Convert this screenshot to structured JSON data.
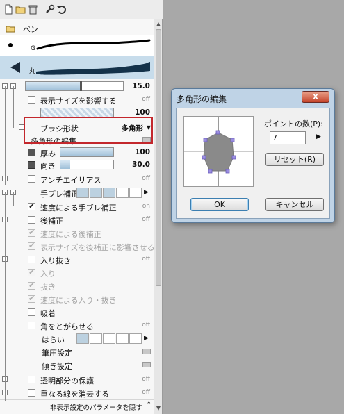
{
  "panel": {
    "brush_tool_label": "ペン",
    "stroke1_label": "G",
    "stroke2_label": "丸",
    "size_value": "15.0",
    "show_size_label": "表示サイズを影響する",
    "show_size_state": "off",
    "density_value": "100",
    "brush_shape_label": "ブラシ形状",
    "brush_shape_value": "多角形",
    "edit_polygon_label": "多角形の編集...",
    "thickness_label": "厚み",
    "thickness_value": "100",
    "direction_label": "向き",
    "direction_value": "30.0",
    "antialias_label": "アンチエイリアス",
    "antialias_state": "off",
    "stabilizer_label": "手ブレ補正",
    "speed_stabilizer_label": "速度による手ブレ補正",
    "speed_stabilizer_state": "on",
    "post_correction_label": "後補正",
    "post_correction_state": "off",
    "speed_post_label": "速度による後補正",
    "show_size_post_label": "表示サイズを後補正に影響させる",
    "taper_label": "入り抜き",
    "taper_state": "off",
    "taper_in_label": "入り",
    "taper_out_label": "抜き",
    "speed_taper_label": "速度による入り・抜き",
    "snap_label": "吸着",
    "sharp_corners_label": "角をとがらせる",
    "sharp_corners_state": "off",
    "flick_label": "はらい",
    "pressure_label": "筆圧設定",
    "tilt_label": "傾き設定",
    "protect_alpha_label": "透明部分の保護",
    "protect_alpha_state": "off",
    "erase_overlap_label": "重なる線を消去する",
    "erase_overlap_state": "off",
    "hide_params_label": "非表示設定のパラメータを隠す"
  },
  "dialog": {
    "title": "多角形の編集",
    "close_label": "X",
    "point_count_label": "ポイントの数(P):",
    "point_count_value": "7",
    "reset_label": "リセット(R)",
    "ok_label": "OK",
    "cancel_label": "キャンセル"
  },
  "colors": {
    "accent_blue": "#bcd1e0",
    "highlight_red": "#c3272c",
    "dialog_frame": "#bfd3e6"
  }
}
